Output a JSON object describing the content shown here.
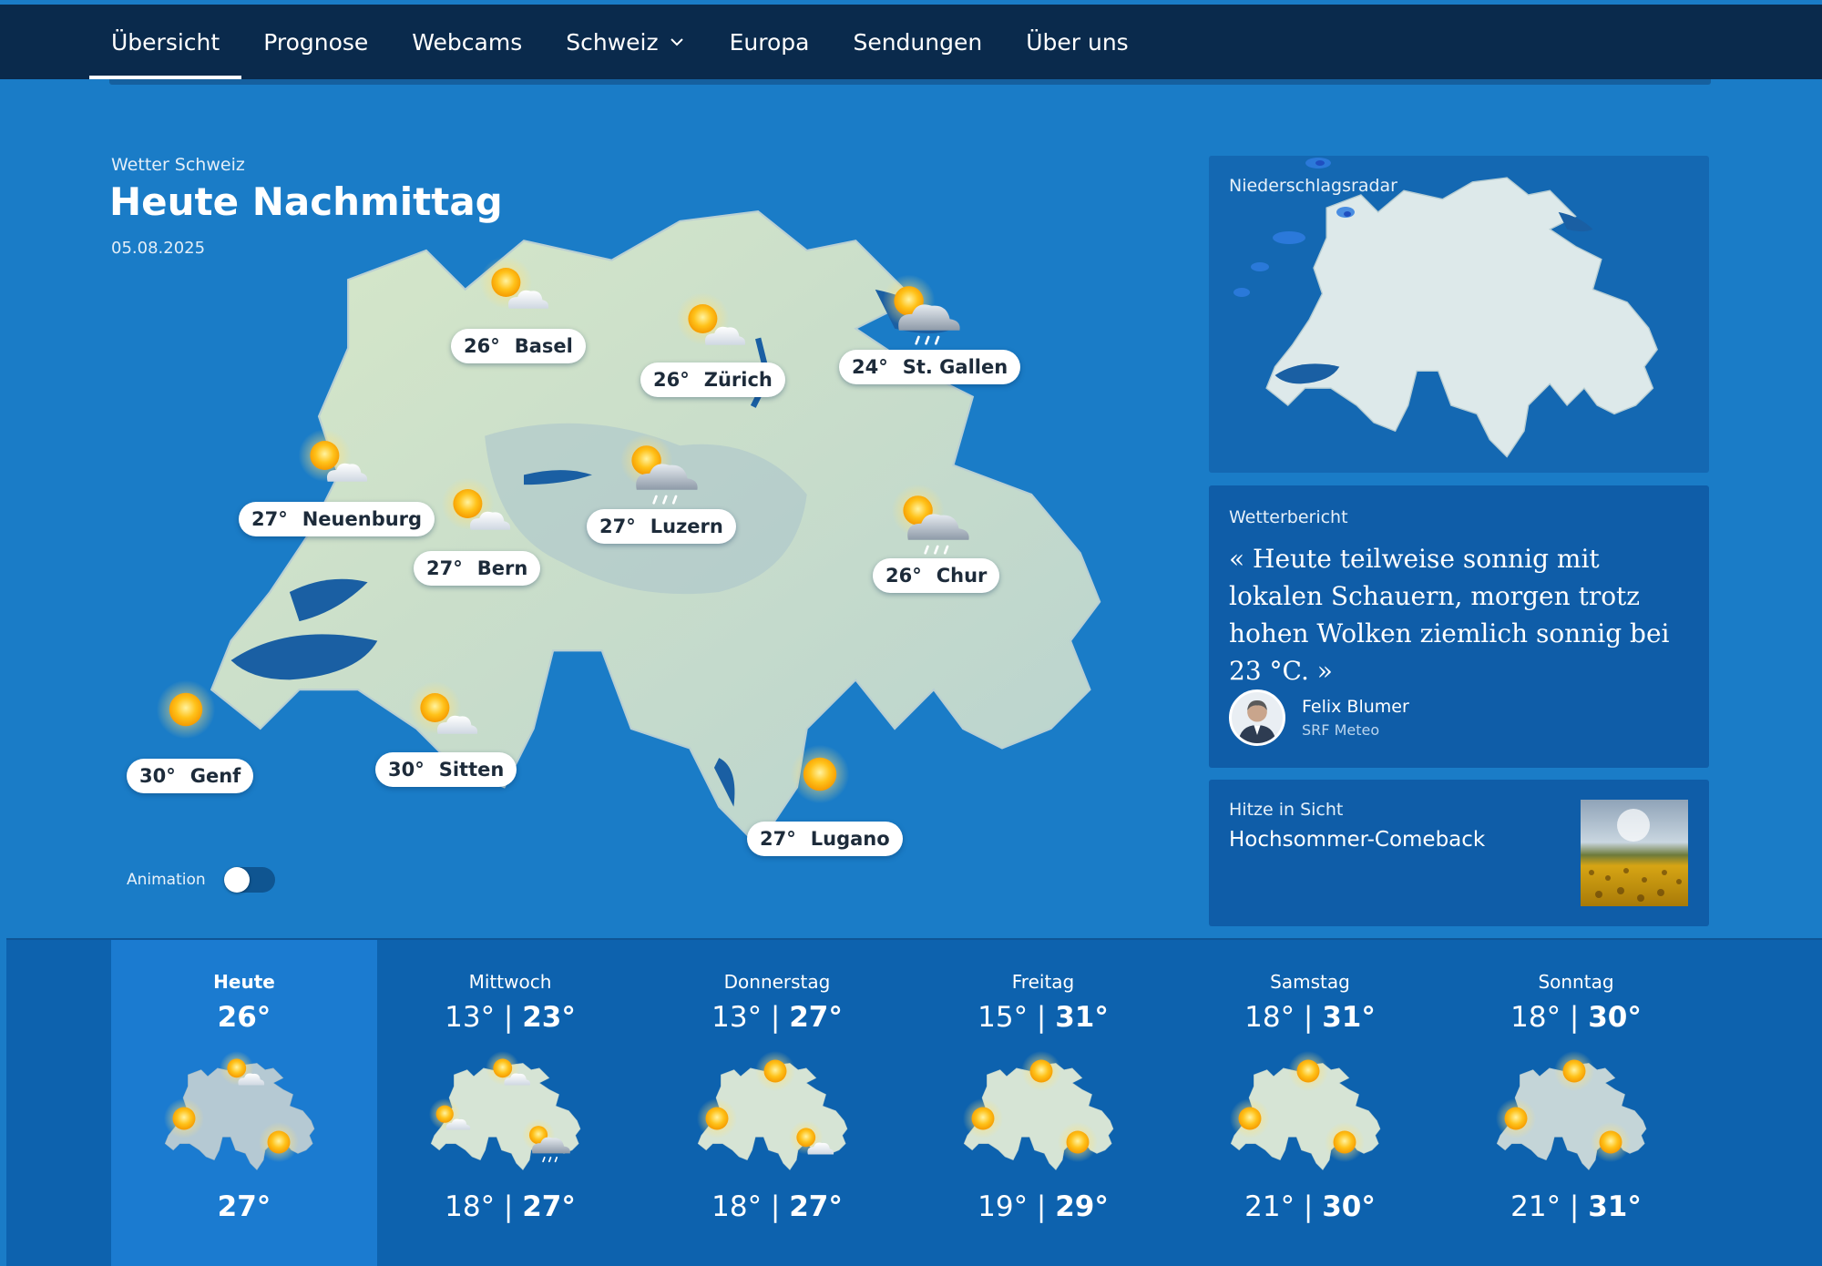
{
  "nav": {
    "items": [
      {
        "label": "Übersicht",
        "active": true
      },
      {
        "label": "Prognose"
      },
      {
        "label": "Webcams"
      },
      {
        "label": "Schweiz",
        "dropdown": true
      },
      {
        "label": "Europa"
      },
      {
        "label": "Sendungen"
      },
      {
        "label": "Über uns"
      }
    ]
  },
  "hero": {
    "kicker": "Wetter Schweiz",
    "title": "Heute Nachmittag",
    "date": "05.08.2025"
  },
  "cities": [
    {
      "name": "Basel",
      "temp": "26°",
      "icon": "sun-cloud-icon"
    },
    {
      "name": "Zürich",
      "temp": "26°",
      "icon": "sun-cloud-icon"
    },
    {
      "name": "St. Gallen",
      "temp": "24°",
      "icon": "sun-cloud-rain-icon"
    },
    {
      "name": "Neuenburg",
      "temp": "27°",
      "icon": "sun-cloud-icon"
    },
    {
      "name": "Bern",
      "temp": "27°",
      "icon": "sun-cloud-icon"
    },
    {
      "name": "Luzern",
      "temp": "27°",
      "icon": "sun-cloud-rain-icon"
    },
    {
      "name": "Chur",
      "temp": "26°",
      "icon": "sun-cloud-rain-icon"
    },
    {
      "name": "Genf",
      "temp": "30°",
      "icon": "sun-icon"
    },
    {
      "name": "Sitten",
      "temp": "30°",
      "icon": "sun-cloud-icon"
    },
    {
      "name": "Lugano",
      "temp": "27°",
      "icon": "sun-icon"
    }
  ],
  "animation": {
    "label": "Animation",
    "on": false
  },
  "radar": {
    "label": "Niederschlagsradar"
  },
  "report": {
    "label": "Wetterbericht",
    "quote": "« Heute teilweise sonnig mit lokalen Schauern, morgen trotz hohen Wolken ziemlich sonnig bei 23 °C. »",
    "author": "Felix Blumer",
    "author_org": "SRF Meteo"
  },
  "teaser": {
    "label": "Hitze in Sicht",
    "title": "Hochsommer-Comeback"
  },
  "forecast": [
    {
      "day": "Heute",
      "top_max": "26°",
      "bottom_max": "27°",
      "active": true
    },
    {
      "day": "Mittwoch",
      "top_min": "13°",
      "top_max": "23°",
      "bottom_min": "18°",
      "bottom_max": "27°"
    },
    {
      "day": "Donnerstag",
      "top_min": "13°",
      "top_max": "27°",
      "bottom_min": "18°",
      "bottom_max": "27°"
    },
    {
      "day": "Freitag",
      "top_min": "15°",
      "top_max": "31°",
      "bottom_min": "19°",
      "bottom_max": "29°"
    },
    {
      "day": "Samstag",
      "top_min": "18°",
      "top_max": "31°",
      "bottom_min": "21°",
      "bottom_max": "30°"
    },
    {
      "day": "Sonntag",
      "top_min": "18°",
      "top_max": "30°",
      "bottom_min": "21°",
      "bottom_max": "31°"
    }
  ],
  "colors": {
    "background": "#1a7cc7",
    "topbar": "#0a2a4c",
    "card": "#0f5da8",
    "sun": "#ffc21a",
    "land": "#cfe1d2"
  }
}
